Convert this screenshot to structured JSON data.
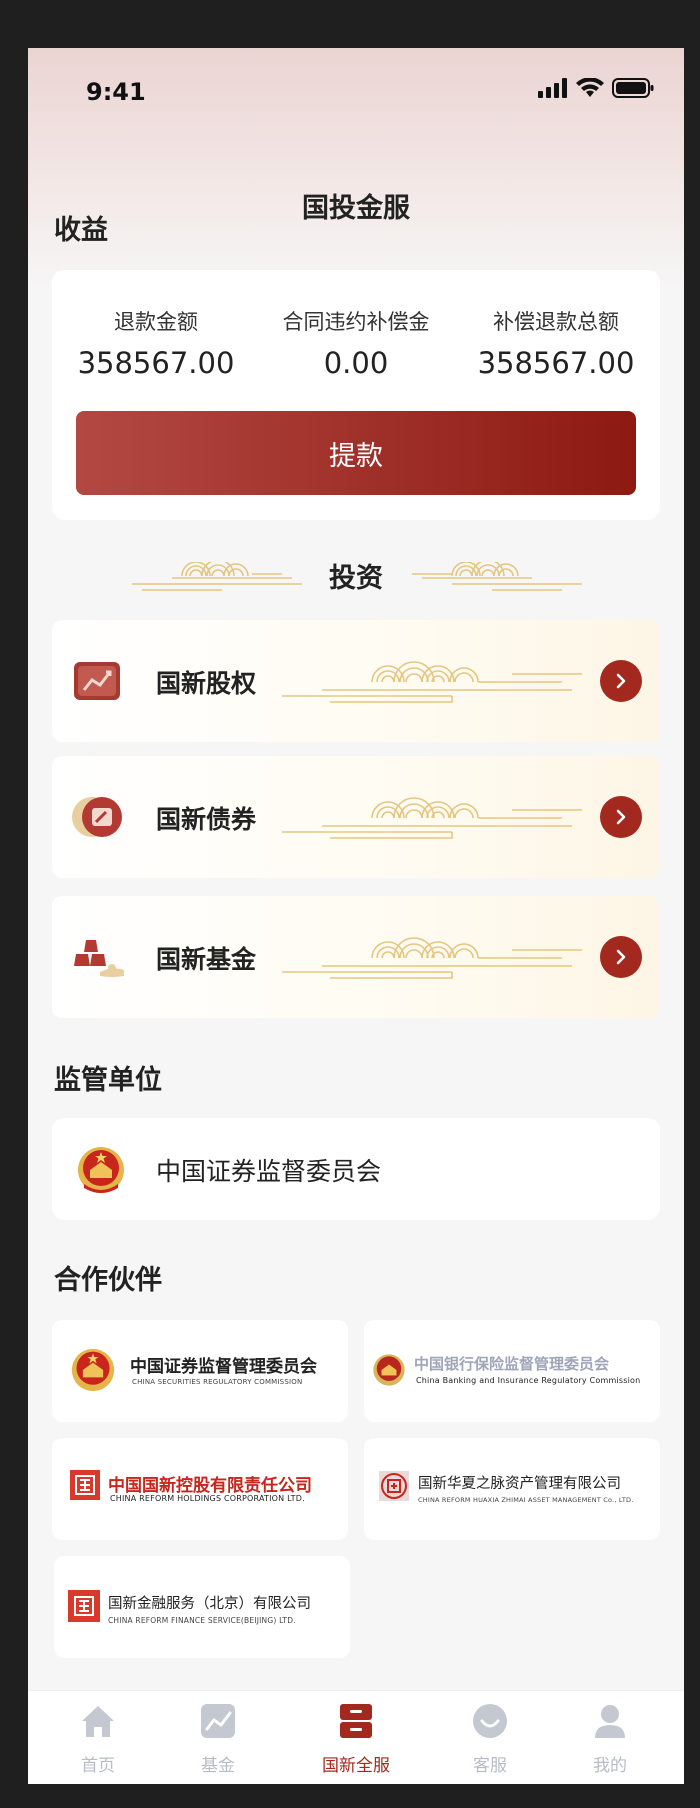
{
  "status_bar": {
    "time": "9:41"
  },
  "app_title": "国投金服",
  "earnings": {
    "section_title": "收益",
    "items": [
      {
        "label": "退款金额",
        "value": "358567.00"
      },
      {
        "label": "合同违约补偿金",
        "value": "0.00"
      },
      {
        "label": "补偿退款总额",
        "value": "358567.00"
      }
    ],
    "withdraw_label": "提款"
  },
  "investment": {
    "section_title": "投资",
    "items": [
      {
        "name": "国新股权",
        "icon": "equity-chart-icon"
      },
      {
        "name": "国新债券",
        "icon": "bond-icon"
      },
      {
        "name": "国新基金",
        "icon": "fund-gold-icon"
      }
    ]
  },
  "regulator": {
    "section_title": "监管单位",
    "name": "中国证券监督委员会"
  },
  "partners": {
    "section_title": "合作伙伴",
    "items": [
      {
        "cn": "中国证券监督管理委员会",
        "en": "CHINA SECURITIES REGULATORY COMMISSION"
      },
      {
        "cn": "中国银行保险监督管理委员会",
        "en": "China Banking and Insurance Regulatory Commission"
      },
      {
        "cn": "中国国新控股有限责任公司",
        "en": "CHINA REFORM HOLDINGS CORPORATION LTD."
      },
      {
        "cn": "国新华夏之脉资产管理有限公司",
        "en": "CHINA REFORM HUAXIA ZHIMAI ASSET MANAGEMENT Co., LTD."
      },
      {
        "cn": "国新金融服务（北京）有限公司",
        "en": "CHINA REFORM  FINANCE SERVICE(BEIJING) LTD."
      }
    ]
  },
  "tabbar": {
    "items": [
      {
        "label": "首页",
        "icon": "home-icon"
      },
      {
        "label": "基金",
        "icon": "fund-chart-icon"
      },
      {
        "label": "国新全服",
        "icon": "service-box-icon",
        "active": true
      },
      {
        "label": "客服",
        "icon": "customer-service-icon"
      },
      {
        "label": "我的",
        "icon": "profile-icon"
      }
    ]
  },
  "colors": {
    "accent": "#a3291f",
    "button_gradient_start": "#b34843",
    "button_gradient_end": "#8d1a12",
    "gold_deco": "#e5c680",
    "inactive_tab": "#b7bcc6"
  }
}
